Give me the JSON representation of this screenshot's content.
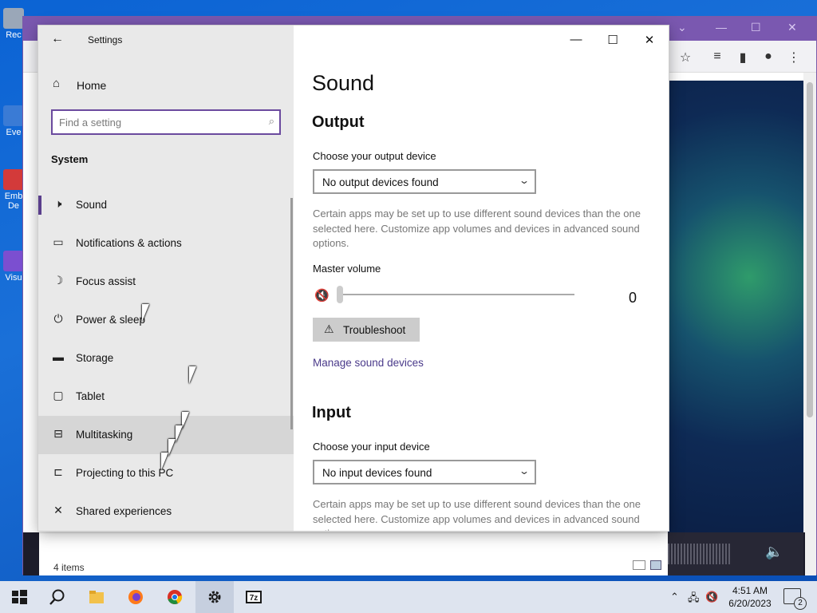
{
  "desktop": {
    "icons": [
      {
        "label": "Rec",
        "color": "#9aa7b8"
      },
      {
        "label": "Eve",
        "color": "#3a7bd5"
      },
      {
        "label": "Emb De",
        "color": "#d33a3a"
      },
      {
        "label": "Visu",
        "color": "#7b4fd0"
      }
    ]
  },
  "browser": {
    "status_items": "4 items"
  },
  "settings": {
    "window_title": "Settings",
    "home_label": "Home",
    "search_placeholder": "Find a setting",
    "section_title": "System",
    "nav_items": [
      {
        "label": "Sound",
        "icon": "speaker-icon"
      },
      {
        "label": "Notifications & actions",
        "icon": "message-icon"
      },
      {
        "label": "Focus assist",
        "icon": "moon-icon"
      },
      {
        "label": "Power & sleep",
        "icon": "power-icon"
      },
      {
        "label": "Storage",
        "icon": "storage-icon"
      },
      {
        "label": "Tablet",
        "icon": "tablet-icon"
      },
      {
        "label": "Multitasking",
        "icon": "multitasking-icon"
      },
      {
        "label": "Projecting to this PC",
        "icon": "projector-icon"
      },
      {
        "label": "Shared experiences",
        "icon": "shared-icon"
      }
    ],
    "page_title": "Sound",
    "output": {
      "heading": "Output",
      "device_label": "Choose your output device",
      "device_value": "No output devices found",
      "description": "Certain apps may be set up to use different sound devices than the one selected here. Customize app volumes and devices in advanced sound options.",
      "master_volume_label": "Master volume",
      "volume_value": "0",
      "troubleshoot_label": "Troubleshoot",
      "manage_link": "Manage sound devices"
    },
    "input": {
      "heading": "Input",
      "device_label": "Choose your input device",
      "device_value": "No input devices found",
      "description": "Certain apps may be set up to use different sound devices than the one selected here. Customize app volumes and devices in advanced sound options."
    }
  },
  "taskbar": {
    "time": "4:51 AM",
    "date": "6/20/2023",
    "notification_count": "2"
  },
  "colors": {
    "accent": "#5a3f8c",
    "link": "#4a3a8a",
    "browser_title": "#7a58b0"
  }
}
